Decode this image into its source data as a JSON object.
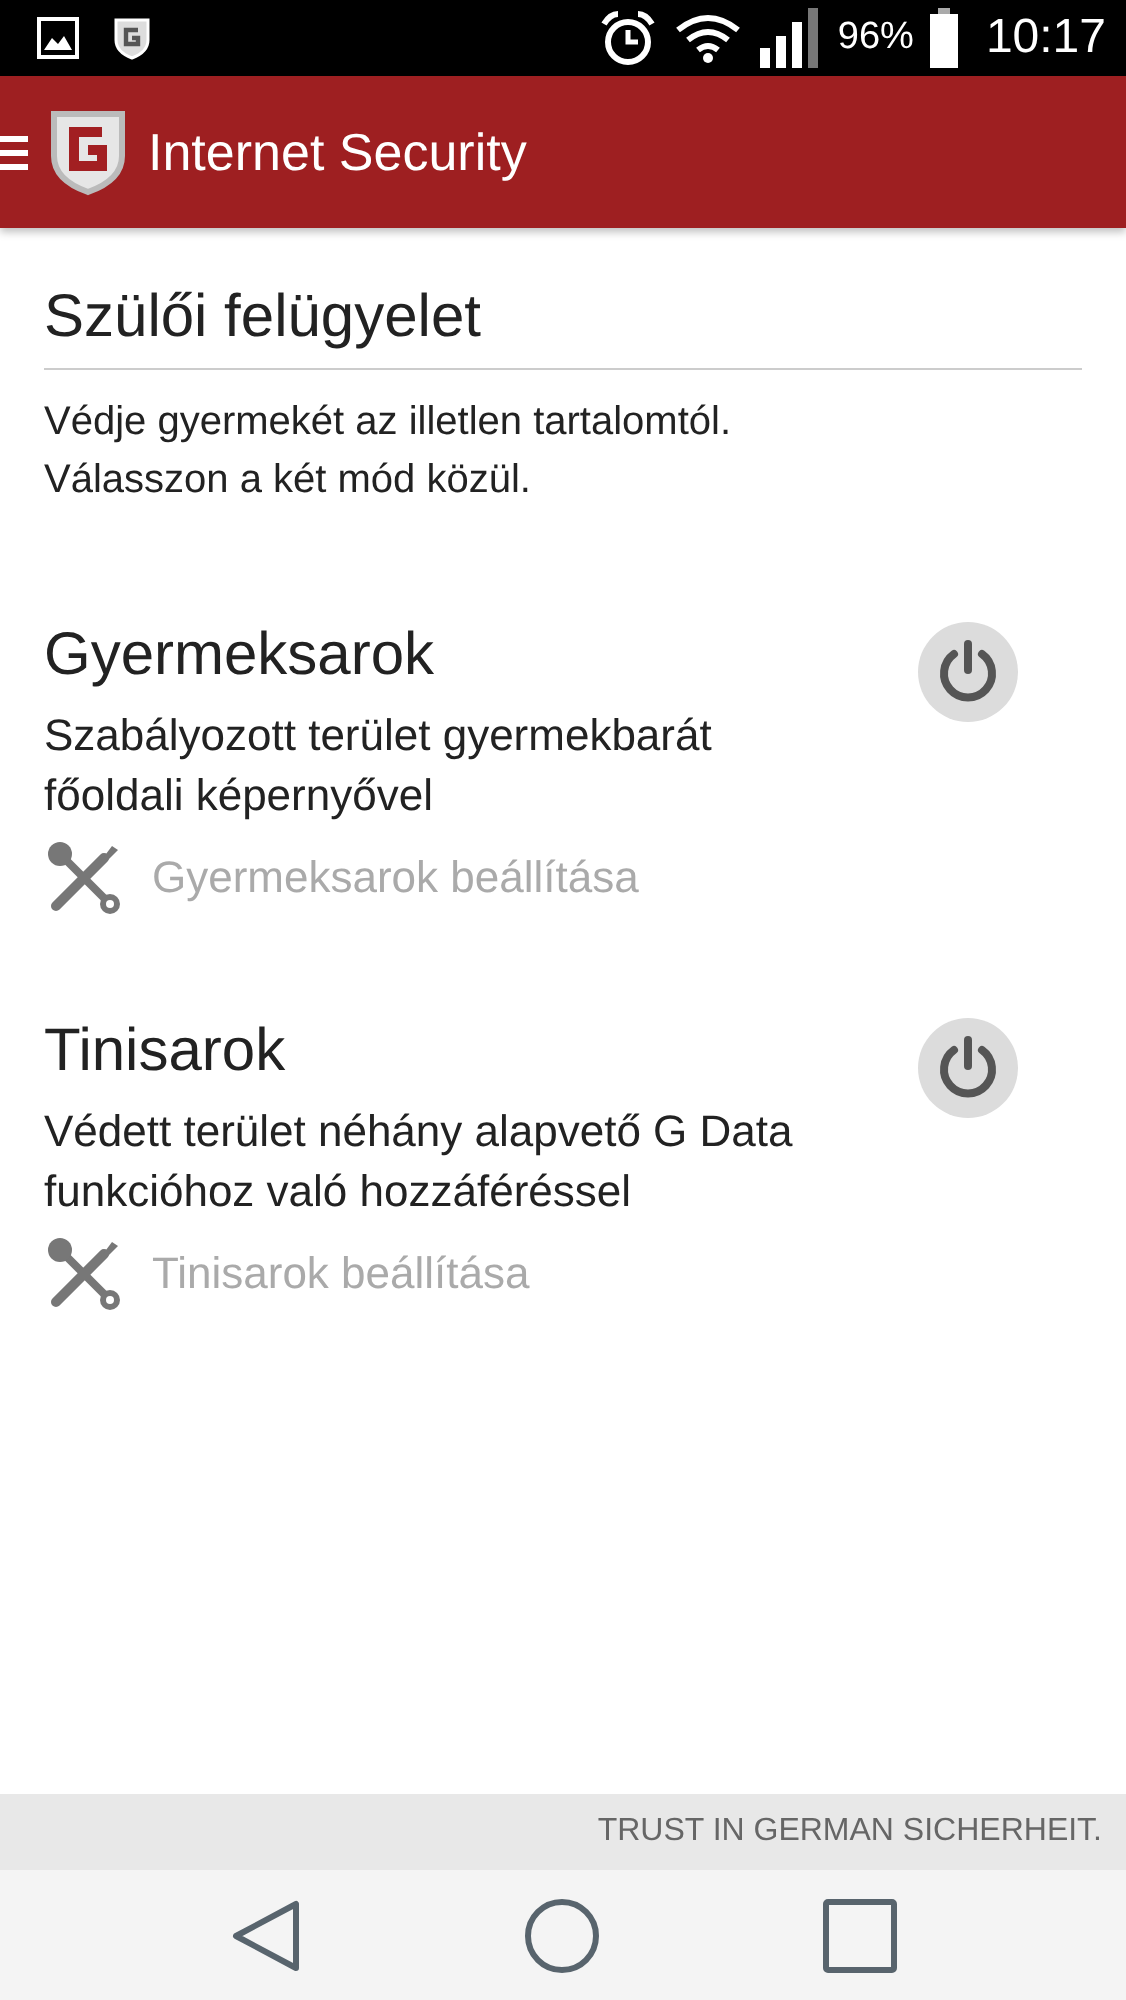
{
  "status_bar": {
    "battery": "96%",
    "time": "10:17"
  },
  "app_bar": {
    "title": "Internet Security"
  },
  "section": {
    "title": "Szülői felügyelet",
    "description": "Védje gyermekét az illetlen tartalomtól. Válasszon a két mód közül."
  },
  "modes": [
    {
      "title": "Gyermeksarok",
      "description": "Szabályozott terület gyermekbarát főoldali képernyővel",
      "on": false,
      "settings": {
        "label": "Gyermeksarok beállítása",
        "disabled": true
      }
    },
    {
      "title": "Tinisarok",
      "description": "Védett terület néhány alapvető G Data funkcióhoz való hozzáféréssel",
      "on": false,
      "settings": {
        "label": "Tinisarok beállítása",
        "disabled": true
      }
    }
  ],
  "footer": {
    "slogan": "TRUST IN GERMAN SICHERHEIT."
  }
}
